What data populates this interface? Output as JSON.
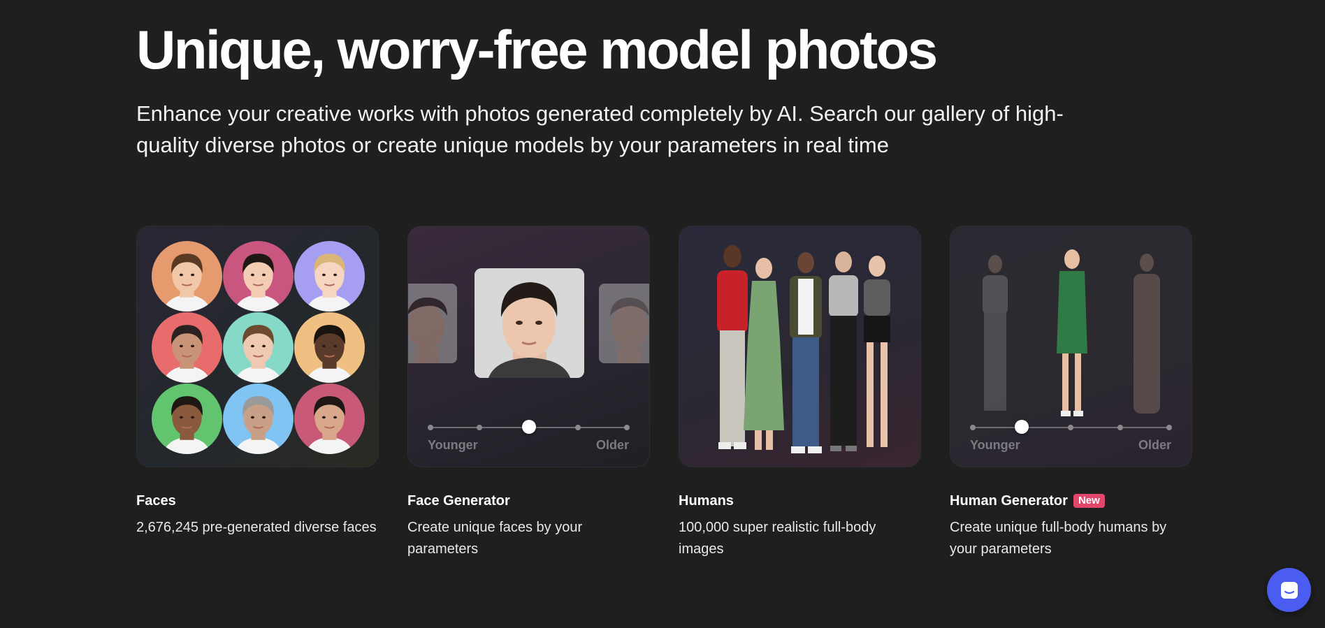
{
  "hero": {
    "title": "Unique, worry-free model photos",
    "subtitle": "Enhance your creative works with photos generated completely by AI. Search our gallery of high-quality diverse photos or create unique models by your parameters in real time"
  },
  "cards": [
    {
      "title": "Faces",
      "description": "2,676,245 pre-generated diverse faces"
    },
    {
      "title": "Face Generator",
      "description": "Create unique faces by your parameters",
      "slider": {
        "min_label": "Younger",
        "max_label": "Older",
        "value": 0.5
      }
    },
    {
      "title": "Humans",
      "description": "100,000 super realistic full-body images"
    },
    {
      "title": "Human Generator",
      "badge": "New",
      "description": "Create unique full-body humans by your parameters",
      "slider": {
        "min_label": "Younger",
        "max_label": "Older",
        "value": 0.25
      }
    }
  ],
  "faces_grid_colors": [
    "#e59b6e",
    "#c8567f",
    "#a69ef0",
    "#e96c6d",
    "#86d8c7",
    "#f0bf82",
    "#62c46f",
    "#7fc4f2",
    "#c85a78"
  ],
  "chat_button": {
    "icon": "chat-icon",
    "color": "#4b5cf0"
  },
  "accent_badge_color": "#e2466b"
}
